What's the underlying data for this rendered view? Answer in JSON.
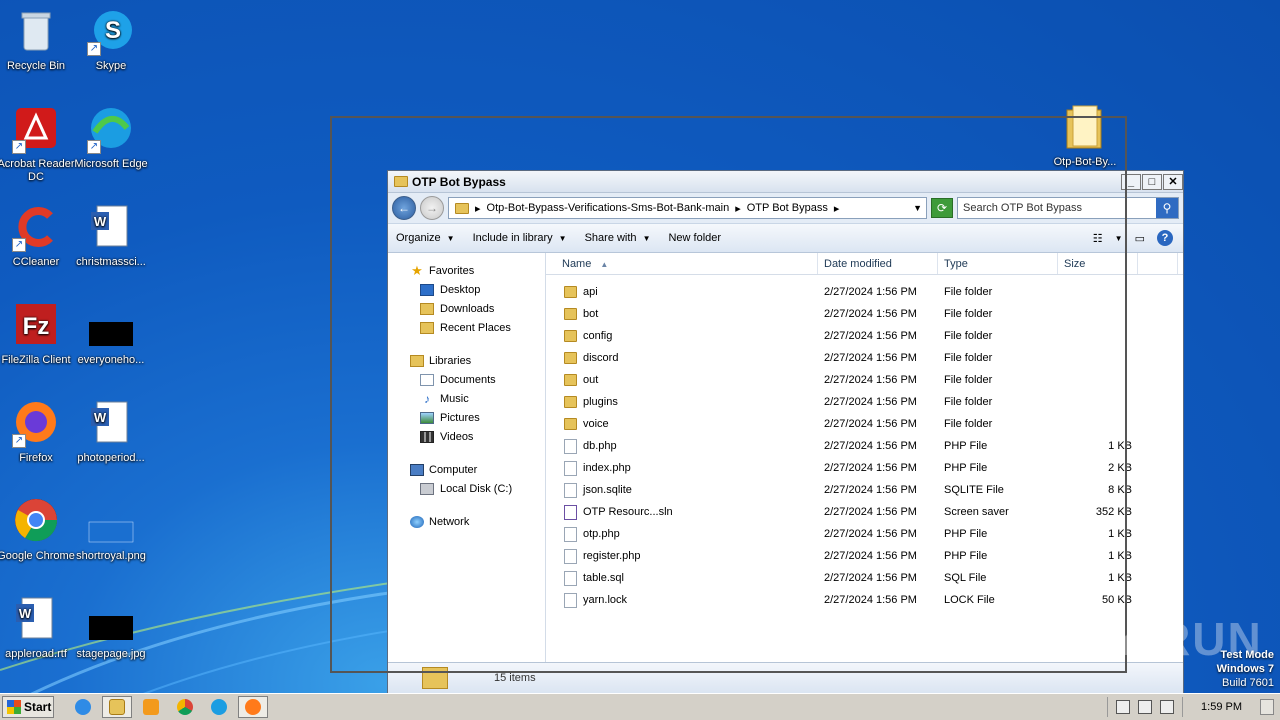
{
  "desktop": {
    "icons": [
      {
        "label": "Recycle Bin",
        "icon": "recycle-bin-icon"
      },
      {
        "label": "Skype",
        "icon": "skype-icon"
      },
      {
        "label": "Acrobat Reader DC",
        "icon": "acrobat-icon"
      },
      {
        "label": "Microsoft Edge",
        "icon": "edge-icon"
      },
      {
        "label": "CCleaner",
        "icon": "ccleaner-icon"
      },
      {
        "label": "christmassci...",
        "icon": "word-doc-icon"
      },
      {
        "label": "FileZilla Client",
        "icon": "filezilla-icon"
      },
      {
        "label": "everyoneho...",
        "icon": "black-image-icon"
      },
      {
        "label": "Firefox",
        "icon": "firefox-icon"
      },
      {
        "label": "photoperiod...",
        "icon": "word-doc-icon"
      },
      {
        "label": "Google Chrome",
        "icon": "chrome-icon"
      },
      {
        "label": "shortroyal.png",
        "icon": "blank-image-icon"
      },
      {
        "label": "appleroad.rtf",
        "icon": "word-doc-icon"
      },
      {
        "label": "stagepage.jpg",
        "icon": "black-image-icon"
      },
      {
        "label": "Otp-Bot-By...",
        "icon": "folder-icon"
      }
    ]
  },
  "window": {
    "title": "OTP Bot Bypass",
    "address": {
      "crumbs": [
        "Otp-Bot-Bypass-Verifications-Sms-Bot-Bank-main",
        "OTP Bot Bypass"
      ]
    },
    "search_placeholder": "Search OTP Bot Bypass",
    "toolbar": {
      "organize": "Organize",
      "include": "Include in library",
      "share": "Share with",
      "new_folder": "New folder"
    },
    "nav": {
      "favorites": "Favorites",
      "desktop": "Desktop",
      "downloads": "Downloads",
      "recent": "Recent Places",
      "libraries": "Libraries",
      "documents": "Documents",
      "music": "Music",
      "pictures": "Pictures",
      "videos": "Videos",
      "computer": "Computer",
      "local_disk": "Local Disk (C:)",
      "network": "Network"
    },
    "columns": {
      "name": "Name",
      "date": "Date modified",
      "type": "Type",
      "size": "Size"
    },
    "files": [
      {
        "name": "api",
        "date": "2/27/2024 1:56 PM",
        "type": "File folder",
        "size": "",
        "kind": "folder"
      },
      {
        "name": "bot",
        "date": "2/27/2024 1:56 PM",
        "type": "File folder",
        "size": "",
        "kind": "folder"
      },
      {
        "name": "config",
        "date": "2/27/2024 1:56 PM",
        "type": "File folder",
        "size": "",
        "kind": "folder"
      },
      {
        "name": "discord",
        "date": "2/27/2024 1:56 PM",
        "type": "File folder",
        "size": "",
        "kind": "folder"
      },
      {
        "name": "out",
        "date": "2/27/2024 1:56 PM",
        "type": "File folder",
        "size": "",
        "kind": "folder"
      },
      {
        "name": "plugins",
        "date": "2/27/2024 1:56 PM",
        "type": "File folder",
        "size": "",
        "kind": "folder"
      },
      {
        "name": "voice",
        "date": "2/27/2024 1:56 PM",
        "type": "File folder",
        "size": "",
        "kind": "folder"
      },
      {
        "name": "db.php",
        "date": "2/27/2024 1:56 PM",
        "type": "PHP File",
        "size": "1 KB",
        "kind": "file"
      },
      {
        "name": "index.php",
        "date": "2/27/2024 1:56 PM",
        "type": "PHP File",
        "size": "2 KB",
        "kind": "file"
      },
      {
        "name": "json.sqlite",
        "date": "2/27/2024 1:56 PM",
        "type": "SQLITE File",
        "size": "8 KB",
        "kind": "file"
      },
      {
        "name": "OTP Resourc...sln",
        "date": "2/27/2024 1:56 PM",
        "type": "Screen saver",
        "size": "352 KB",
        "kind": "sln"
      },
      {
        "name": "otp.php",
        "date": "2/27/2024 1:56 PM",
        "type": "PHP File",
        "size": "1 KB",
        "kind": "file"
      },
      {
        "name": "register.php",
        "date": "2/27/2024 1:56 PM",
        "type": "PHP File",
        "size": "1 KB",
        "kind": "file"
      },
      {
        "name": "table.sql",
        "date": "2/27/2024 1:56 PM",
        "type": "SQL File",
        "size": "1 KB",
        "kind": "file"
      },
      {
        "name": "yarn.lock",
        "date": "2/27/2024 1:56 PM",
        "type": "LOCK File",
        "size": "50 KB",
        "kind": "file"
      }
    ],
    "status": "15 items"
  },
  "watermark": {
    "text": "ANY RUN",
    "line1": "Test Mode",
    "line2": "Windows 7",
    "line3": "Build 7601"
  },
  "taskbar": {
    "start": "Start",
    "clock": "1:59 PM",
    "apps": [
      "ie-icon",
      "explorer-icon",
      "media-player-icon",
      "chrome-icon",
      "edge-icon",
      "firefox-icon"
    ]
  }
}
